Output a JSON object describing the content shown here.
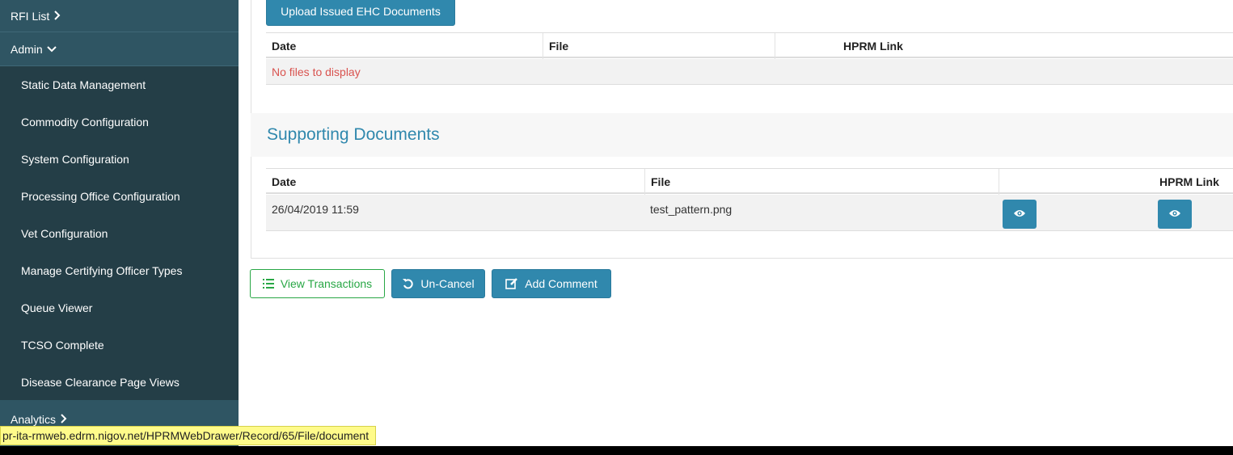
{
  "sidebar": {
    "rfi_list": "RFI List",
    "admin": "Admin",
    "admin_items": [
      "Static Data Management",
      "Commodity Configuration",
      "System Configuration",
      "Processing Office Configuration",
      "Vet Configuration",
      "Manage Certifying Officer Types",
      "Queue Viewer",
      "TCSO Complete",
      "Disease Clearance Page Views"
    ],
    "analytics": "Analytics"
  },
  "issued_docs": {
    "upload_button": "Upload Issued EHC Documents",
    "columns": [
      "Date",
      "File",
      "",
      "HPRM Link"
    ],
    "empty_message": "No files to display",
    "empty_color": "#d9534f"
  },
  "supporting_docs": {
    "title": "Supporting Documents",
    "columns": [
      "Date",
      "File",
      "",
      "HPRM Link"
    ],
    "rows": [
      {
        "date": "26/04/2019 11:59",
        "file": "test_pattern.png"
      }
    ]
  },
  "actions": {
    "view_transactions": "View Transactions",
    "un_cancel": "Un-Cancel",
    "add_comment": "Add Comment"
  },
  "status_url": "pr-ita-rmweb.edrm.nigov.net/HPRMWebDrawer/Record/65/File/document",
  "colors": {
    "sidebar": "#2b4b55",
    "primary": "#3088ad",
    "success": "#28a745"
  }
}
